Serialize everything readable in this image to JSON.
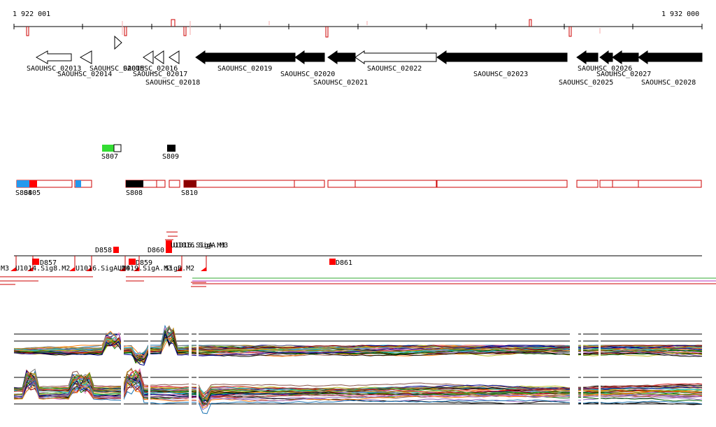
{
  "coords": {
    "start": "1 922 001",
    "end": "1 932 000"
  },
  "genes": [
    {
      "label": "SAOUHSC_02013",
      "filled": false
    },
    {
      "label": "SAOUHSC_02014",
      "filled": false
    },
    {
      "label": "SAOUHSC_02015",
      "filled": false
    },
    {
      "label": "SAOUHSC_02016",
      "filled": false
    },
    {
      "label": "SAOUHSC_02017",
      "filled": false
    },
    {
      "label": "SAOUHSC_02018",
      "filled": false
    },
    {
      "label": "SAOUHSC_02019",
      "filled": true
    },
    {
      "label": "SAOUHSC_02020",
      "filled": true
    },
    {
      "label": "SAOUHSC_02021",
      "filled": true
    },
    {
      "label": "SAOUHSC_02022",
      "filled": false
    },
    {
      "label": "SAOUHSC_02023",
      "filled": true
    },
    {
      "label": "SAOUHSC_02025",
      "filled": true
    },
    {
      "label": "SAOUHSC_02026",
      "filled": true
    },
    {
      "label": "SAOUHSC_02027",
      "filled": true
    },
    {
      "label": "SAOUHSC_02028",
      "filled": true
    }
  ],
  "segments": [
    {
      "label": "S804"
    },
    {
      "label": "S805"
    },
    {
      "label": "S807"
    },
    {
      "label": "S808"
    },
    {
      "label": "S809"
    },
    {
      "label": "S810"
    }
  ],
  "features": [
    {
      "label": "D857"
    },
    {
      "label": "D858"
    },
    {
      "label": "D859"
    },
    {
      "label": "D860"
    },
    {
      "label": "D861"
    }
  ],
  "sig_labels": [
    {
      "label": "U1016.SigA.M3"
    },
    {
      "label": "M3"
    },
    {
      "label": "U1014.Sig8.M2"
    },
    {
      "label": "U1016.SigA.M4"
    },
    {
      "label": "U1019.SigA.M3"
    },
    {
      "label": "SigB.M2"
    }
  ],
  "colors": {
    "axis": "#000000",
    "accent_red": "#ff0000",
    "outline_red": "#cc0000",
    "green": "#33dd33",
    "blue": "#2299ee",
    "dark_red": "#8b0000"
  }
}
